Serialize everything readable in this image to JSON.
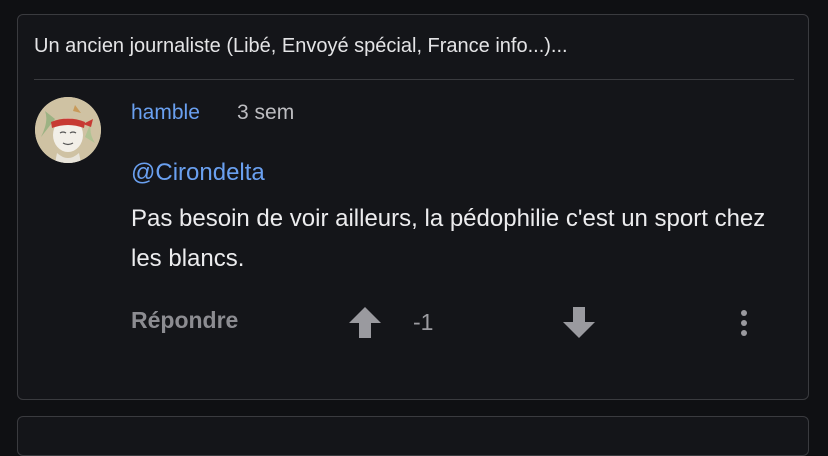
{
  "thread": {
    "quoted_excerpt": "Un ancien journaliste (Libé, Envoyé spécial, France info...)..."
  },
  "comment": {
    "author": "hamble",
    "timestamp": "3 sem",
    "mention": "@Cirondelta",
    "body": "Pas besoin de voir ailleurs, la pédophilie c'est un sport chez les blancs."
  },
  "actions": {
    "reply_label": "Répondre",
    "score": "-1",
    "upvote_icon": "arrow-up-icon",
    "downvote_icon": "arrow-down-icon",
    "more_icon": "more-vertical-icon"
  },
  "colors": {
    "background": "#0f1013",
    "card": "#141519",
    "border": "#3a3b3f",
    "link": "#6aa0f0",
    "text": "#ececee",
    "muted": "#8c8c91"
  }
}
